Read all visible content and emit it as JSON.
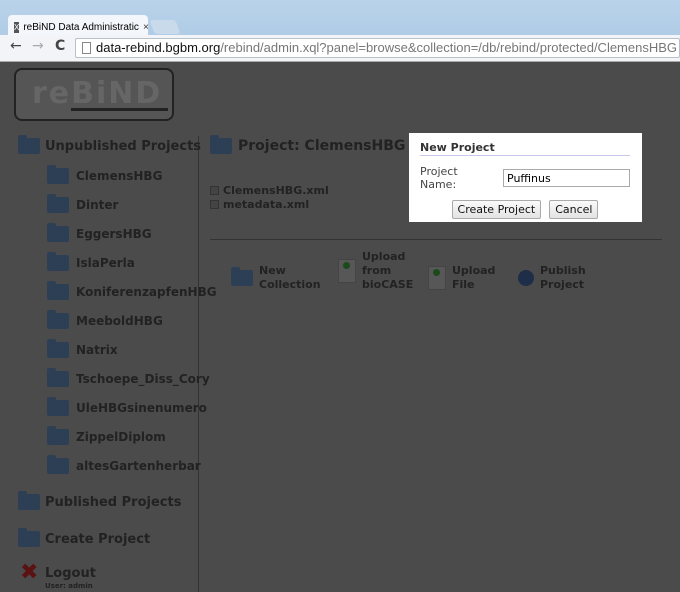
{
  "browser": {
    "tab_title": "reBiND Data Administratic",
    "url_host": "data-rebind.bgbm.org",
    "url_path": "/rebind/admin.xql?panel=browse&collection=/db/rebind/protected/ClemensHBG"
  },
  "logo": "reBiND",
  "sidebar": {
    "unpublished_label": "Unpublished Projects",
    "projects": [
      "ClemensHBG",
      "Dinter",
      "EggersHBG",
      "IslaPerla",
      "KoniferenzapfenHBG",
      "MeeboldHBG",
      "Natrix",
      "Tschoepe_Diss_Cory",
      "UleHBGsinenumero",
      "ZippelDiplom",
      "altesGartenherbar"
    ],
    "published_label": "Published Projects",
    "create_label": "Create Project",
    "logout_label": "Logout",
    "user_label": "User: admin"
  },
  "main": {
    "title": "Project: ClemensHBG",
    "files": [
      "ClemensHBG.xml",
      "metadata.xml"
    ],
    "actions": [
      [
        "New",
        "Collection"
      ],
      [
        "Upload",
        "from",
        "bioCASE"
      ],
      [
        "Upload",
        "File"
      ],
      [
        "Publish",
        "Project"
      ]
    ]
  },
  "dialog": {
    "title": "New Project",
    "field_label": "Project Name:",
    "field_value": "Puffinus",
    "create_button": "Create Project",
    "cancel_button": "Cancel"
  }
}
